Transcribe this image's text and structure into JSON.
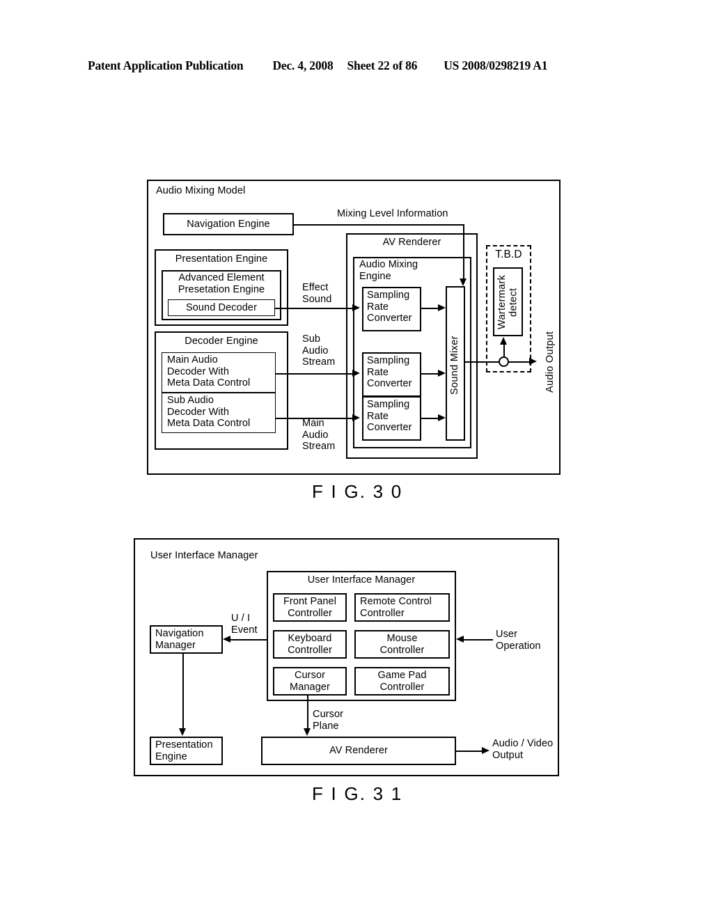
{
  "header": {
    "publication": "Patent Application Publication",
    "date": "Dec. 4, 2008",
    "sheet": "Sheet 22 of 86",
    "patent_number": "US 2008/0298219 A1"
  },
  "figure30": {
    "caption": "F I G. 3 0",
    "frame_title": "Audio Mixing Model",
    "boxes": {
      "navigation_engine": "Navigation Engine",
      "presentation_engine": "Presentation Engine",
      "advanced_element_presentation_engine": "Advanced Element\nPresetation Engine",
      "sound_decoder": "Sound Decoder",
      "decoder_engine": "Decoder Engine",
      "main_audio_decoder": "Main Audio\nDecoder With\nMeta Data Control",
      "sub_audio_decoder": "Sub Audio\nDecoder With\nMeta Data Control",
      "av_renderer": "AV Renderer",
      "audio_mixing_engine": "Audio Mixing\nEngine",
      "sampling_rate_converter_1": "Sampling\nRate\nConverter",
      "sampling_rate_converter_2": "Sampling\nRate\nConverter",
      "sampling_rate_converter_3": "Sampling\nRate\nConverter",
      "sound_mixer": "Sound Mixer",
      "tbd": "T.B.D",
      "watermark_detect": "Wartermark\ndetect"
    },
    "labels": {
      "mixing_level_information": "Mixing Level Information",
      "effect_sound": "Effect\nSound",
      "sub_audio_stream": "Sub\nAudio\nStream",
      "main_audio_stream": "Main\nAudio\nStream",
      "audio_output": "Audio Output"
    }
  },
  "figure31": {
    "caption": "F I G. 3 1",
    "frame_title": "User Interface Manager",
    "boxes": {
      "uim_inner_title": "User Interface Manager",
      "front_panel_controller": "Front Panel\nController",
      "remote_control_controller": "Remote Control\nController",
      "keyboard_controller": "Keyboard\nController",
      "mouse_controller": "Mouse\nController",
      "cursor_manager": "Cursor\nManager",
      "game_pad_controller": "Game Pad\nController",
      "navigation_manager": "Navigation\nManager",
      "presentation_engine": "Presentation\nEngine",
      "av_renderer": "AV Renderer"
    },
    "labels": {
      "ui_event": "U / I\nEvent",
      "user_operation": "User\nOperation",
      "cursor_plane": "Cursor\nPlane",
      "audio_video_output": "Audio / Video\nOutput"
    }
  }
}
